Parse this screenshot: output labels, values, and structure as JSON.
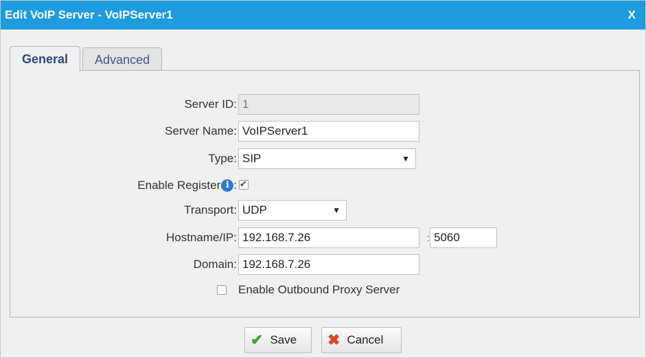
{
  "dialog": {
    "title": "Edit VoIP Server - VoIPServer1",
    "close_label": "X"
  },
  "tabs": [
    {
      "label": "General",
      "active": true
    },
    {
      "label": "Advanced",
      "active": false
    }
  ],
  "form": {
    "server_id": {
      "label": "Server ID:",
      "value": "1"
    },
    "server_name": {
      "label": "Server Name:",
      "value": "VoIPServer1"
    },
    "type": {
      "label": "Type:",
      "value": "SIP"
    },
    "enable_register": {
      "label": "Enable Register",
      "label_suffix": ":",
      "checked": true,
      "info_icon": "i"
    },
    "transport": {
      "label": "Transport:",
      "value": "UDP"
    },
    "hostname": {
      "label": "Hostname/IP:",
      "value": "192.168.7.26",
      "port_separator": ":",
      "port": "5060"
    },
    "domain": {
      "label": "Domain:",
      "value": "192.168.7.26"
    },
    "outbound_proxy": {
      "label": "Enable Outbound Proxy Server",
      "checked": false
    }
  },
  "buttons": {
    "save": {
      "label": "Save",
      "icon": "check-icon"
    },
    "cancel": {
      "label": "Cancel",
      "icon": "x-icon"
    }
  },
  "colors": {
    "titlebar": "#1e9ce0",
    "save_icon": "#3aa62a",
    "cancel_icon": "#e0442a"
  }
}
